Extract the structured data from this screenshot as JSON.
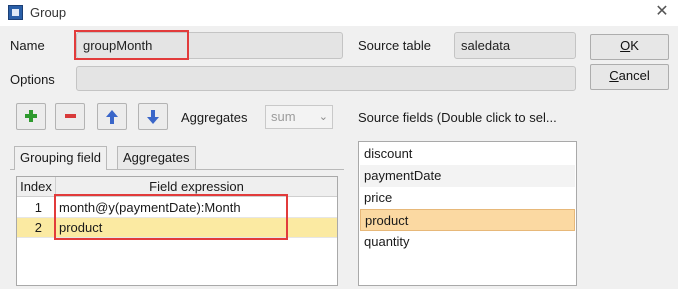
{
  "window": {
    "title": "Group",
    "close_label": "✕"
  },
  "form": {
    "name_label": "Name",
    "name_value": "groupMonth",
    "source_table_label": "Source table",
    "source_table_value": "saledata",
    "options_label": "Options",
    "options_value": ""
  },
  "buttons": {
    "ok": "OK",
    "ok_mnemonic": "O",
    "cancel": "Cancel",
    "cancel_mnemonic": "C"
  },
  "toolbar": {
    "aggregates_label": "Aggregates",
    "aggregate_select_value": "sum",
    "icons": [
      "add-icon",
      "remove-icon",
      "arrow-up-icon",
      "arrow-down-icon"
    ]
  },
  "tabs": [
    {
      "label": "Grouping field",
      "active": true
    },
    {
      "label": "Aggregates",
      "active": false
    }
  ],
  "table": {
    "columns": [
      "Index",
      "Field expression"
    ],
    "rows": [
      {
        "index": "1",
        "expression": "month@y(paymentDate):Month",
        "selected": false
      },
      {
        "index": "2",
        "expression": "product",
        "selected": true
      }
    ]
  },
  "source_fields": {
    "label": "Source fields (Double click to sel...",
    "items": [
      {
        "label": "discount",
        "selected": false
      },
      {
        "label": "paymentDate",
        "selected": false
      },
      {
        "label": "price",
        "selected": false
      },
      {
        "label": "product",
        "selected": true
      },
      {
        "label": "quantity",
        "selected": false
      }
    ]
  },
  "colors": {
    "highlight_red": "#e23b3b",
    "row_selected": "#fbeaa2",
    "list_selected": "#fbd9a2"
  }
}
